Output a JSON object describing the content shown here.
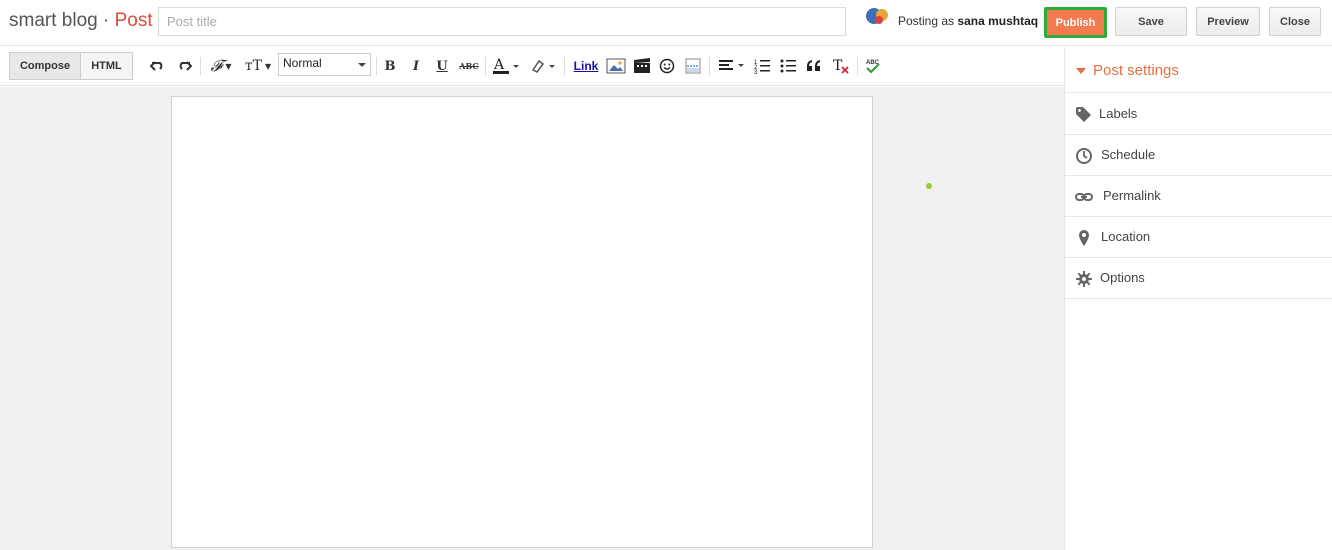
{
  "header": {
    "blog_name": "smart blog",
    "separator": " · ",
    "post_word": "Post",
    "title_placeholder": "Post title",
    "posting_as_prefix": "Posting as",
    "user_name": "sana mushtaq"
  },
  "actions": {
    "publish": "Publish",
    "save": "Save",
    "preview": "Preview",
    "close": "Close"
  },
  "toolbar": {
    "compose": "Compose",
    "html": "HTML",
    "format_value": "Normal",
    "link_label": "Link",
    "bold": "B",
    "italic": "I",
    "underline": "U",
    "strike": "ABC"
  },
  "post_settings": {
    "title": "Post settings",
    "items": [
      {
        "label": "Labels",
        "icon": "tag-icon"
      },
      {
        "label": "Schedule",
        "icon": "clock-icon"
      },
      {
        "label": "Permalink",
        "icon": "link-icon"
      },
      {
        "label": "Location",
        "icon": "location-pin-icon"
      },
      {
        "label": "Options",
        "icon": "gear-icon"
      }
    ]
  },
  "colors": {
    "publish_bg": "#f3794e",
    "publish_border": "#2fab3a",
    "accent": "#e5703d"
  }
}
